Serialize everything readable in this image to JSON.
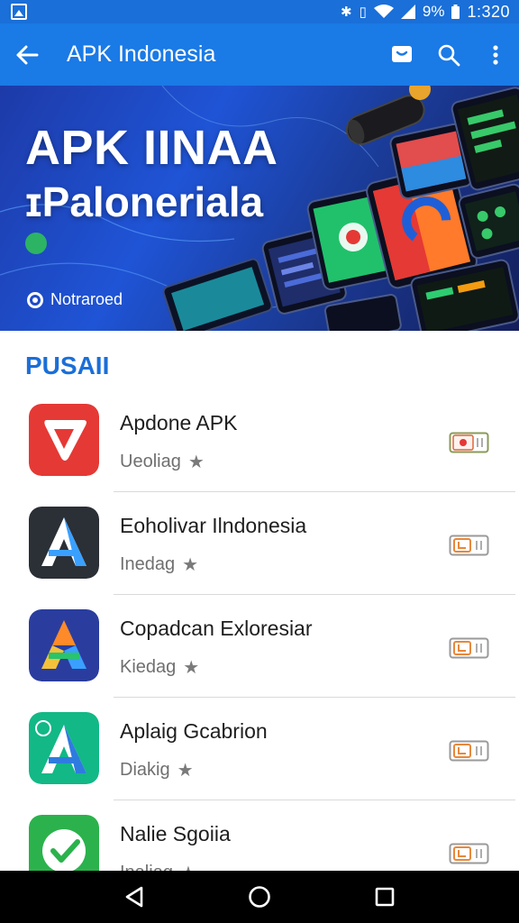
{
  "status_bar": {
    "battery_percent": "9%",
    "time": "1:320"
  },
  "app_bar": {
    "title": "APK Indonesia"
  },
  "banner": {
    "headline": "APK IINAA",
    "subheadline": "ɪPaloneriala",
    "badge_text": "Notraroed"
  },
  "section": {
    "title": "PUSAII"
  },
  "apps": [
    {
      "name": "Apdone APK",
      "subtitle": "Ueoliag",
      "icon": "play-logo-icon",
      "icon_bg": "#e53935",
      "action_icon": "record-toggle-icon"
    },
    {
      "name": "Eoholivar Ilndonesia",
      "subtitle": "Inedag",
      "icon": "a-logo-dark-icon",
      "icon_bg": "#2b2f36",
      "action_icon": "download-toggle-icon"
    },
    {
      "name": "Copadcan Exloresiar",
      "subtitle": "Kiedag",
      "icon": "a-logo-multicolor-icon",
      "icon_bg": "#2a3d9e",
      "action_icon": "download-toggle-icon"
    },
    {
      "name": "Aplaig Gcabrion",
      "subtitle": "Diakig",
      "icon": "a-logo-green-icon",
      "icon_bg": "#12b886",
      "action_icon": "download-toggle-icon"
    },
    {
      "name": "Nalie Sgoiia",
      "subtitle": "Inaliag",
      "icon": "check-logo-icon",
      "icon_bg": "#2bb24c",
      "action_icon": "download-toggle-icon"
    }
  ],
  "colors": {
    "status_bar": "#1a6fd8",
    "app_bar": "#1a7ae6",
    "accent": "#1a6fd8",
    "action_orange": "#e8883a"
  }
}
